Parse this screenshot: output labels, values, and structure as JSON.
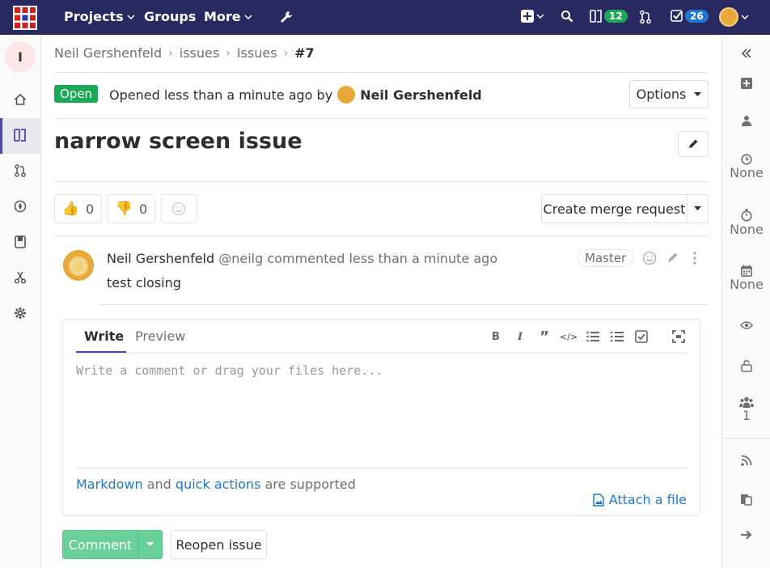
{
  "topnav": {
    "projects_label": "Projects",
    "groups_label": "Groups",
    "more_label": "More",
    "mr_count": "12",
    "todo_count": "26"
  },
  "sidebar": {
    "project_initial": "I"
  },
  "breadcrumb": {
    "items": [
      "Neil Gershenfeld",
      "issues",
      "Issues"
    ],
    "current": "#7"
  },
  "issue": {
    "status": "Open",
    "opened_text": "Opened less than a minute ago by",
    "author": "Neil Gershenfeld",
    "title": "narrow screen issue",
    "options_label": "Options",
    "thumbs_up": "0",
    "thumbs_down": "0",
    "create_mr_label": "Create merge request"
  },
  "note": {
    "author": "Neil Gershenfeld",
    "handle": "@neilg",
    "action": "commented less than a minute ago",
    "role": "Master",
    "body": "test closing"
  },
  "editor": {
    "write_tab": "Write",
    "preview_tab": "Preview",
    "placeholder": "Write a comment or drag your files here...",
    "md_link": "Markdown",
    "md_and": "and",
    "qa_link": "quick actions",
    "md_suffix": "are supported",
    "attach_label": "Attach a file"
  },
  "actions": {
    "comment_label": "Comment",
    "reopen_label": "Reopen issue"
  },
  "right_sidebar": {
    "milestone": "None",
    "time_tracking": "None",
    "due_date": "None",
    "participants_count": "1"
  },
  "colors": {
    "nav_bg": "#292961",
    "open_green": "#1aaa55",
    "link_blue": "#1f78d1",
    "comment_green": "#69d099"
  }
}
